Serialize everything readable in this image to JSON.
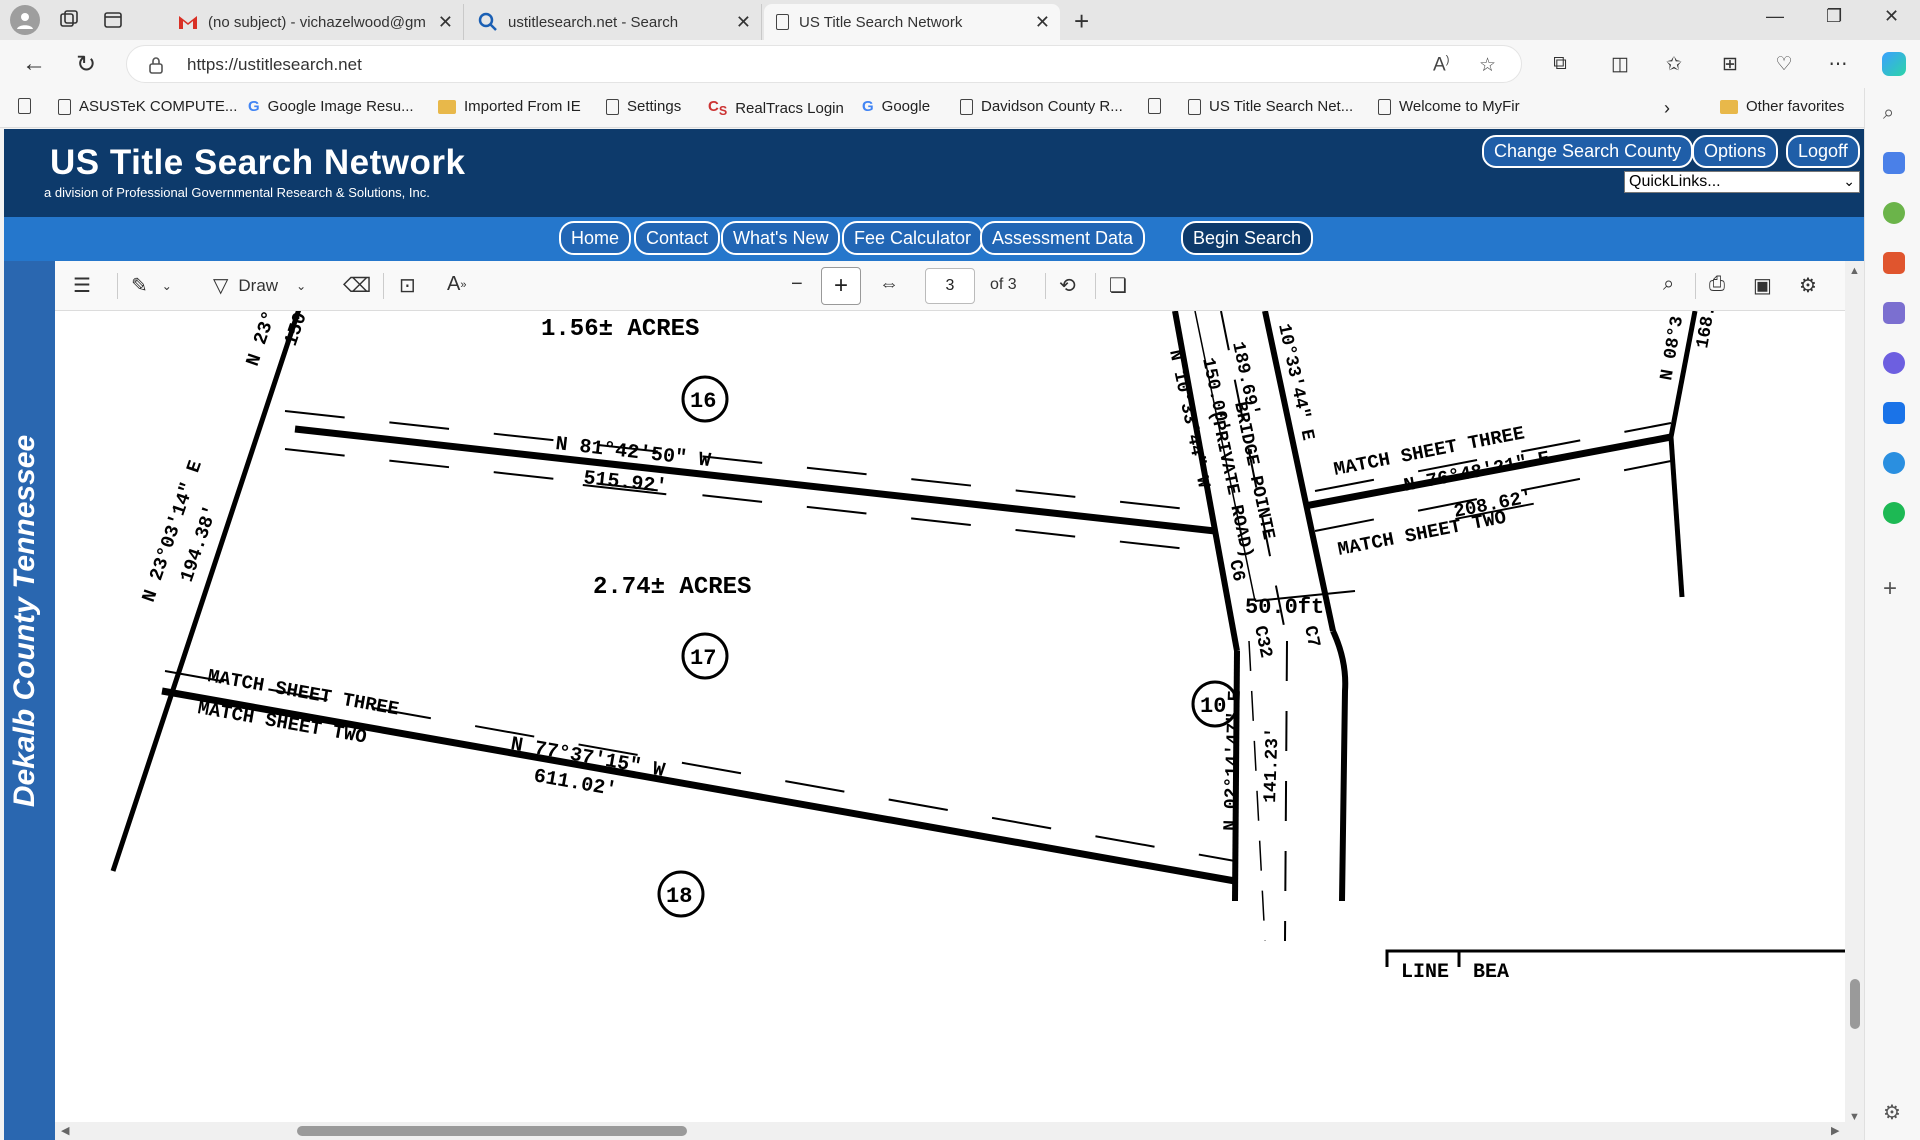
{
  "browser": {
    "tabs": [
      {
        "title": "(no subject) - vichazelwood@gm",
        "icon": "gmail-icon"
      },
      {
        "title": "ustitlesearch.net - Search",
        "icon": "search-icon"
      },
      {
        "title": "US Title Search Network",
        "icon": "page-icon",
        "active": true
      }
    ],
    "url": "https://ustitlesearch.net",
    "bookmarks": [
      {
        "label": "ASUSTeK COMPUTE...",
        "icon": "page-icon"
      },
      {
        "label": "Google Image Resu...",
        "icon": "google-icon"
      },
      {
        "label": "Imported From IE",
        "icon": "folder-icon"
      },
      {
        "label": "Settings",
        "icon": "page-icon"
      },
      {
        "label": "RealTracs Login",
        "icon": "realtracs-icon"
      },
      {
        "label": "Google",
        "icon": "google-icon"
      },
      {
        "label": "Davidson County R...",
        "icon": "page-icon"
      },
      {
        "label": "US Title Search Net...",
        "icon": "page-icon"
      },
      {
        "label": "Welcome to MyFir",
        "icon": "page-icon"
      }
    ],
    "other_favorites": "Other favorites"
  },
  "site": {
    "title": "US Title Search Network",
    "subtitle": "a division of Professional Governmental Research & Solutions, Inc.",
    "header_buttons": [
      "Change Search County",
      "Options",
      "Logoff"
    ],
    "quicklinks": "QuickLinks...",
    "nav": [
      "Home",
      "Contact",
      "What's New",
      "Fee Calculator",
      "Assessment Data",
      "Begin Search"
    ],
    "county": "Dekalb County Tennessee"
  },
  "pdf": {
    "draw_label": "Draw",
    "page": "3",
    "of": "of 3"
  },
  "plat": {
    "acres_top": "1.56± ACRES",
    "acres_mid": "2.74± ACRES",
    "lot16": "16",
    "lot17": "17",
    "lot18": "18",
    "lot10": "10",
    "bearing_top": "N 81°42'50\" W",
    "dist_top": "515.92'",
    "bearing_left": "N 23°03'14\" E",
    "dist_left": "194.38'",
    "bearing_left_top": "N 23°0",
    "dist_left_top": "150.",
    "match_three_left": "MATCH SHEET THREE",
    "match_two_left": "MATCH SHEET TWO",
    "bearing_bottom": "N 77°37'15\" W",
    "dist_bottom": "611.02'",
    "bearing_road_a": "N 10°33'44\" W",
    "dist_road_a": "150.00'",
    "dist_road_b": "189.69'",
    "bearing_road_b": "10°33'44\" E",
    "road_name1": "BRIDGE POINTE",
    "road_name2": "(PRIVATE ROAD)",
    "row_width": "50.0ft",
    "c6": "C6",
    "c32": "C32",
    "c7": "C7",
    "bearing_road_c": "N 02°14'47\" E",
    "dist_road_c": "141.23'",
    "match_three_right": "MATCH SHEET THREE",
    "bearing_right": "N 76°48'21\" E",
    "dist_right": "208.62'",
    "match_two_right": "MATCH SHEET TWO",
    "bearing_right_top": "N 08°3",
    "dist_right_top": "168.",
    "table_line": "LINE",
    "table_bearing": "BEA"
  }
}
